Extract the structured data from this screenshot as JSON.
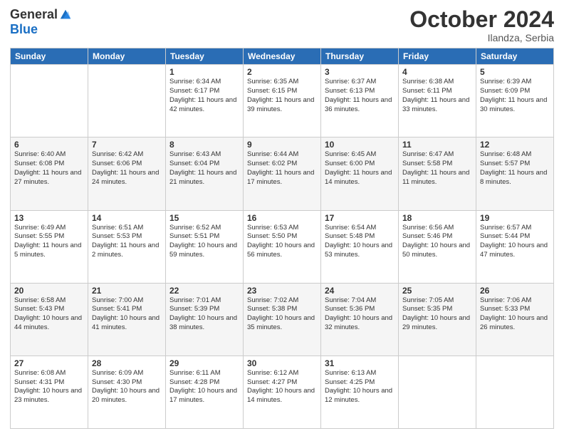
{
  "header": {
    "logo_general": "General",
    "logo_blue": "Blue",
    "month": "October 2024",
    "location": "Ilandza, Serbia"
  },
  "days_of_week": [
    "Sunday",
    "Monday",
    "Tuesday",
    "Wednesday",
    "Thursday",
    "Friday",
    "Saturday"
  ],
  "weeks": [
    [
      {
        "day": "",
        "info": ""
      },
      {
        "day": "",
        "info": ""
      },
      {
        "day": "1",
        "info": "Sunrise: 6:34 AM\nSunset: 6:17 PM\nDaylight: 11 hours and 42 minutes."
      },
      {
        "day": "2",
        "info": "Sunrise: 6:35 AM\nSunset: 6:15 PM\nDaylight: 11 hours and 39 minutes."
      },
      {
        "day": "3",
        "info": "Sunrise: 6:37 AM\nSunset: 6:13 PM\nDaylight: 11 hours and 36 minutes."
      },
      {
        "day": "4",
        "info": "Sunrise: 6:38 AM\nSunset: 6:11 PM\nDaylight: 11 hours and 33 minutes."
      },
      {
        "day": "5",
        "info": "Sunrise: 6:39 AM\nSunset: 6:09 PM\nDaylight: 11 hours and 30 minutes."
      }
    ],
    [
      {
        "day": "6",
        "info": "Sunrise: 6:40 AM\nSunset: 6:08 PM\nDaylight: 11 hours and 27 minutes."
      },
      {
        "day": "7",
        "info": "Sunrise: 6:42 AM\nSunset: 6:06 PM\nDaylight: 11 hours and 24 minutes."
      },
      {
        "day": "8",
        "info": "Sunrise: 6:43 AM\nSunset: 6:04 PM\nDaylight: 11 hours and 21 minutes."
      },
      {
        "day": "9",
        "info": "Sunrise: 6:44 AM\nSunset: 6:02 PM\nDaylight: 11 hours and 17 minutes."
      },
      {
        "day": "10",
        "info": "Sunrise: 6:45 AM\nSunset: 6:00 PM\nDaylight: 11 hours and 14 minutes."
      },
      {
        "day": "11",
        "info": "Sunrise: 6:47 AM\nSunset: 5:58 PM\nDaylight: 11 hours and 11 minutes."
      },
      {
        "day": "12",
        "info": "Sunrise: 6:48 AM\nSunset: 5:57 PM\nDaylight: 11 hours and 8 minutes."
      }
    ],
    [
      {
        "day": "13",
        "info": "Sunrise: 6:49 AM\nSunset: 5:55 PM\nDaylight: 11 hours and 5 minutes."
      },
      {
        "day": "14",
        "info": "Sunrise: 6:51 AM\nSunset: 5:53 PM\nDaylight: 11 hours and 2 minutes."
      },
      {
        "day": "15",
        "info": "Sunrise: 6:52 AM\nSunset: 5:51 PM\nDaylight: 10 hours and 59 minutes."
      },
      {
        "day": "16",
        "info": "Sunrise: 6:53 AM\nSunset: 5:50 PM\nDaylight: 10 hours and 56 minutes."
      },
      {
        "day": "17",
        "info": "Sunrise: 6:54 AM\nSunset: 5:48 PM\nDaylight: 10 hours and 53 minutes."
      },
      {
        "day": "18",
        "info": "Sunrise: 6:56 AM\nSunset: 5:46 PM\nDaylight: 10 hours and 50 minutes."
      },
      {
        "day": "19",
        "info": "Sunrise: 6:57 AM\nSunset: 5:44 PM\nDaylight: 10 hours and 47 minutes."
      }
    ],
    [
      {
        "day": "20",
        "info": "Sunrise: 6:58 AM\nSunset: 5:43 PM\nDaylight: 10 hours and 44 minutes."
      },
      {
        "day": "21",
        "info": "Sunrise: 7:00 AM\nSunset: 5:41 PM\nDaylight: 10 hours and 41 minutes."
      },
      {
        "day": "22",
        "info": "Sunrise: 7:01 AM\nSunset: 5:39 PM\nDaylight: 10 hours and 38 minutes."
      },
      {
        "day": "23",
        "info": "Sunrise: 7:02 AM\nSunset: 5:38 PM\nDaylight: 10 hours and 35 minutes."
      },
      {
        "day": "24",
        "info": "Sunrise: 7:04 AM\nSunset: 5:36 PM\nDaylight: 10 hours and 32 minutes."
      },
      {
        "day": "25",
        "info": "Sunrise: 7:05 AM\nSunset: 5:35 PM\nDaylight: 10 hours and 29 minutes."
      },
      {
        "day": "26",
        "info": "Sunrise: 7:06 AM\nSunset: 5:33 PM\nDaylight: 10 hours and 26 minutes."
      }
    ],
    [
      {
        "day": "27",
        "info": "Sunrise: 6:08 AM\nSunset: 4:31 PM\nDaylight: 10 hours and 23 minutes."
      },
      {
        "day": "28",
        "info": "Sunrise: 6:09 AM\nSunset: 4:30 PM\nDaylight: 10 hours and 20 minutes."
      },
      {
        "day": "29",
        "info": "Sunrise: 6:11 AM\nSunset: 4:28 PM\nDaylight: 10 hours and 17 minutes."
      },
      {
        "day": "30",
        "info": "Sunrise: 6:12 AM\nSunset: 4:27 PM\nDaylight: 10 hours and 14 minutes."
      },
      {
        "day": "31",
        "info": "Sunrise: 6:13 AM\nSunset: 4:25 PM\nDaylight: 10 hours and 12 minutes."
      },
      {
        "day": "",
        "info": ""
      },
      {
        "day": "",
        "info": ""
      }
    ]
  ]
}
